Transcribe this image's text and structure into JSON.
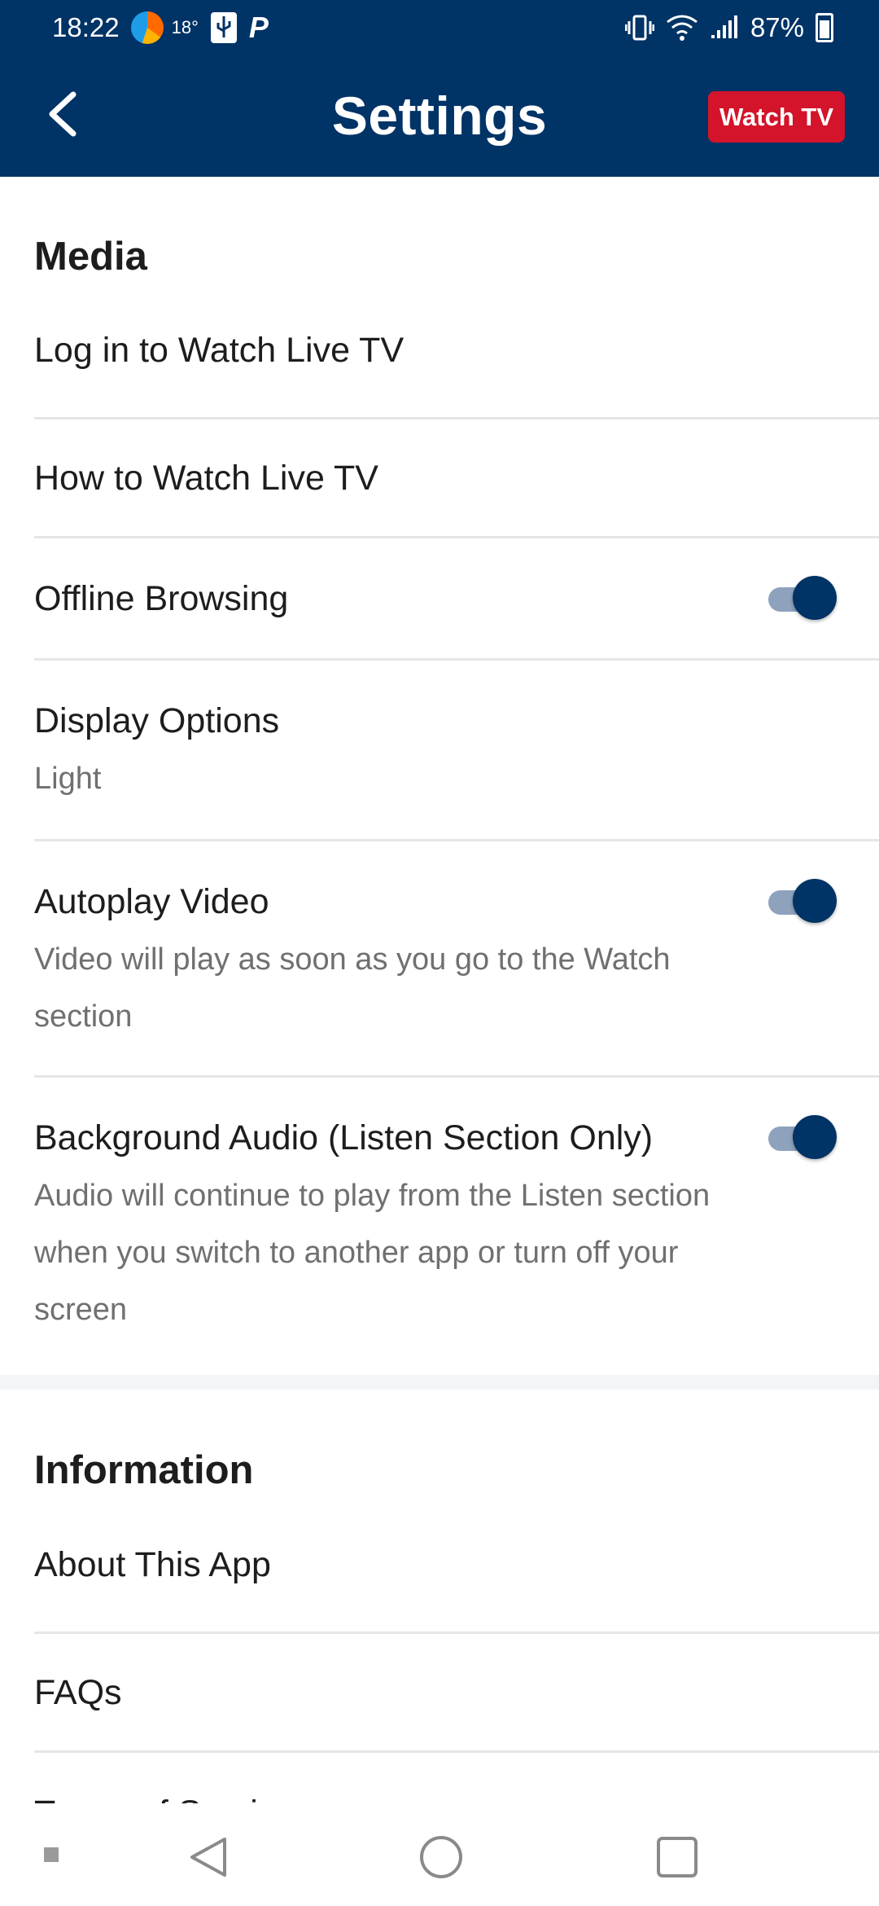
{
  "status_bar": {
    "time": "18:22",
    "temperature": "18°",
    "battery": "87%",
    "icons": [
      "weather-icon",
      "usb-icon",
      "p-icon",
      "vibrate-icon",
      "wifi-icon",
      "signal-icon",
      "battery-icon"
    ]
  },
  "header": {
    "title": "Settings",
    "back_icon": "chevron-left-icon",
    "watch_tv_label": "Watch TV",
    "background": "#003366",
    "accent": "#d3142a"
  },
  "media": {
    "heading": "Media",
    "items": [
      {
        "label": "Log in to Watch Live TV"
      },
      {
        "label": "How to Watch Live TV"
      },
      {
        "label": "Offline Browsing",
        "toggle": true
      },
      {
        "label": "Display Options",
        "value": "Light"
      },
      {
        "label": "Autoplay Video",
        "toggle": true,
        "description": "Video will play as soon as you go to the Watch section"
      },
      {
        "label": "Background Audio (Listen Section Only)",
        "toggle": true,
        "description": "Audio will continue to play from the Listen section when you switch to another app or turn off your screen"
      }
    ]
  },
  "information": {
    "heading": "Information",
    "items": [
      {
        "label": "About This App"
      },
      {
        "label": "FAQs"
      },
      {
        "label": "Terms of Service"
      }
    ]
  },
  "nav_bar": {
    "icons": [
      "square-dot-icon",
      "back-triangle-icon",
      "home-circle-icon",
      "recents-square-icon"
    ]
  }
}
